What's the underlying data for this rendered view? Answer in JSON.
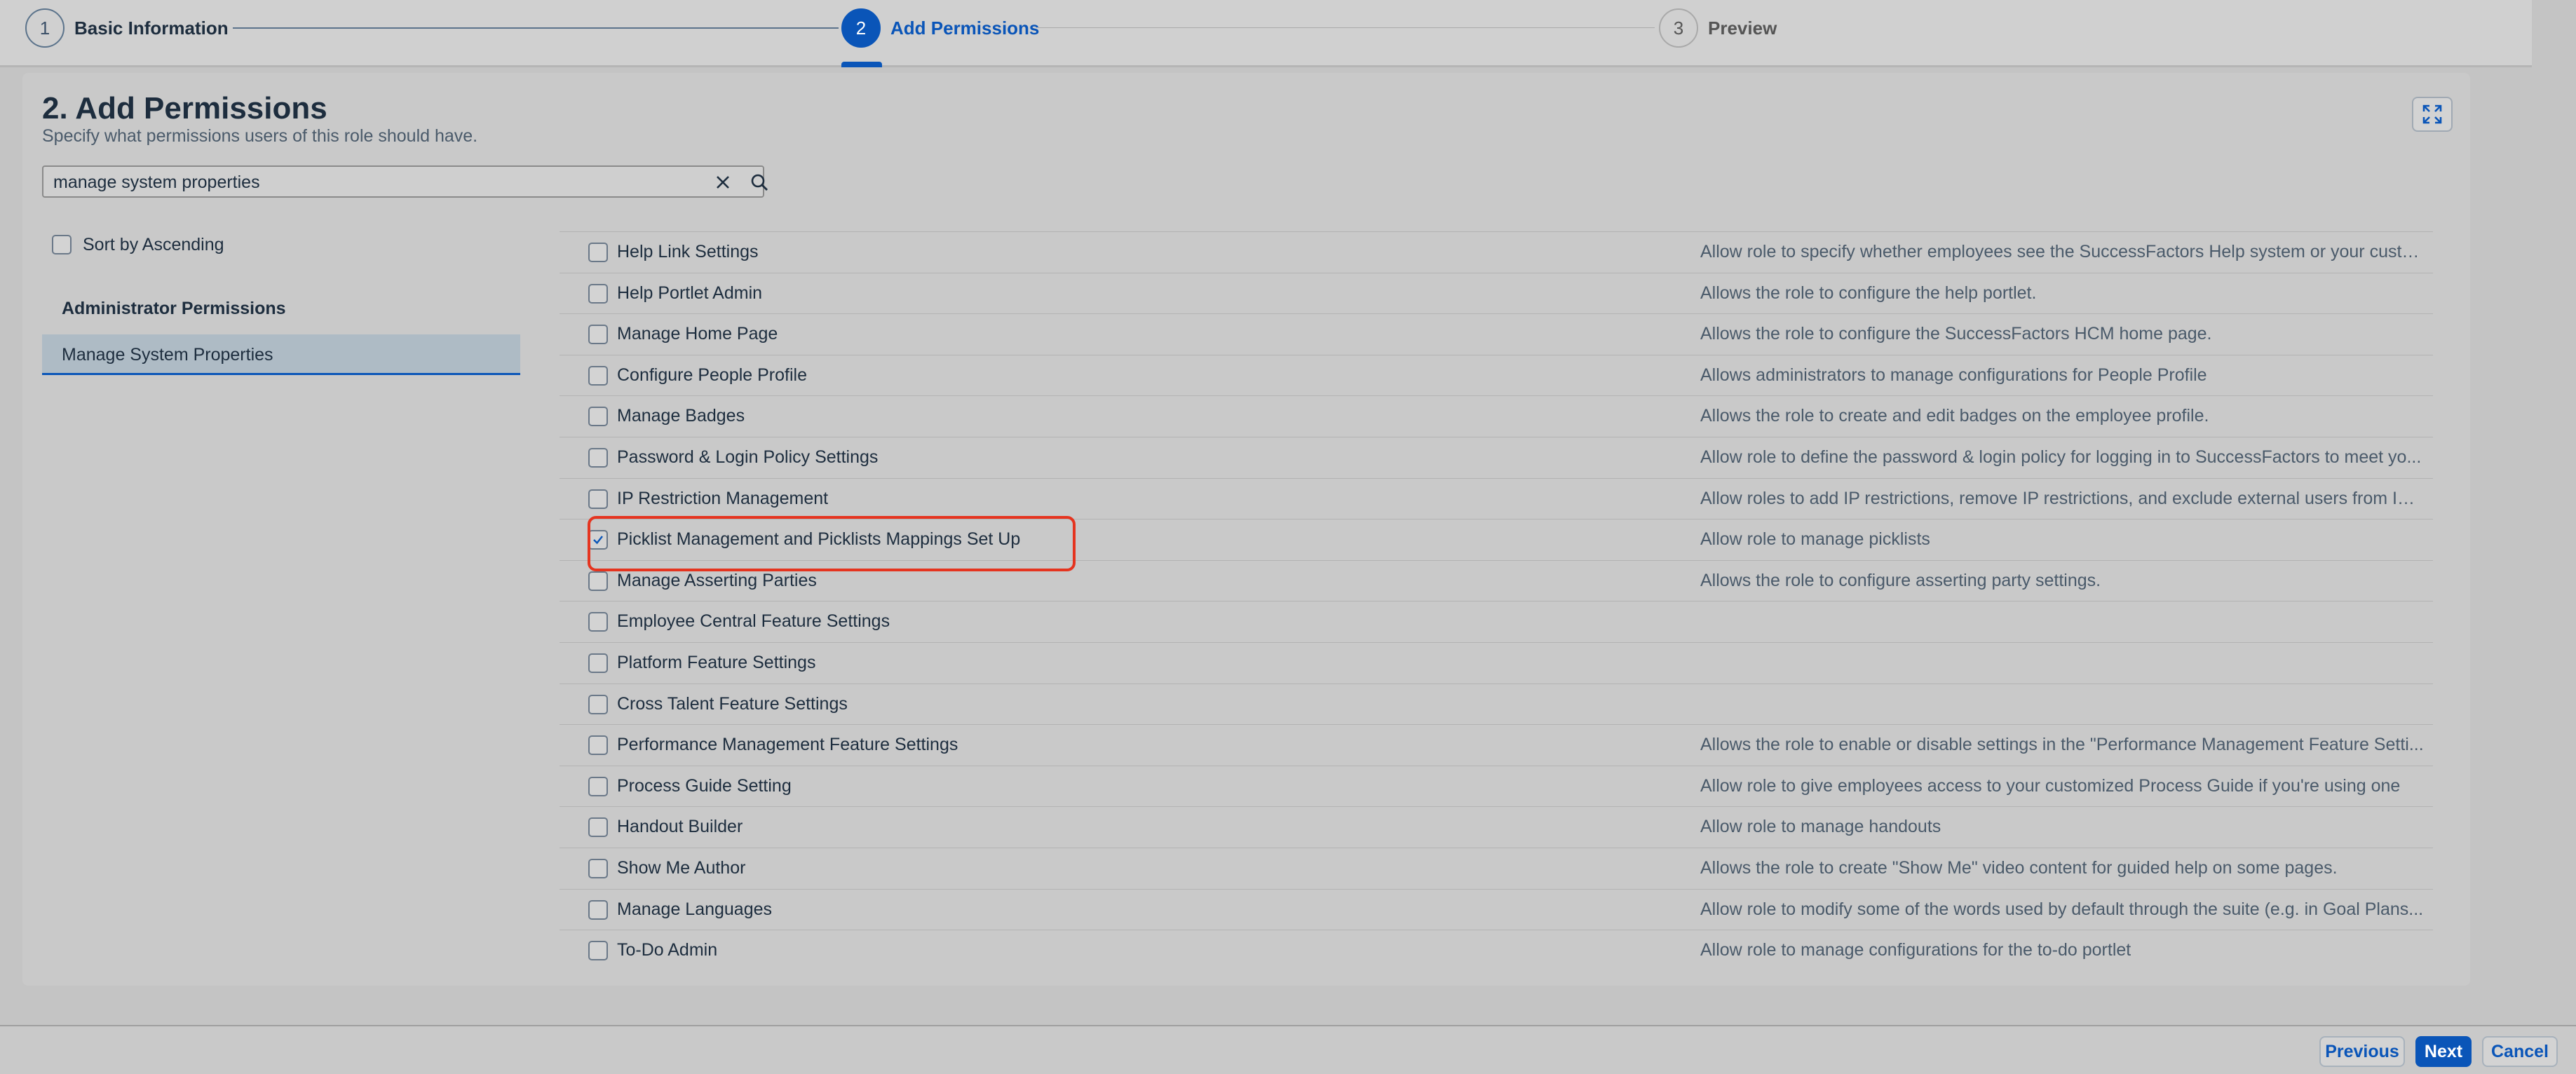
{
  "wizard": {
    "steps": [
      {
        "number": "1",
        "label": "Basic Information",
        "state": "completed"
      },
      {
        "number": "2",
        "label": "Add Permissions",
        "state": "active"
      },
      {
        "number": "3",
        "label": "Preview",
        "state": "disabled"
      }
    ]
  },
  "page": {
    "title": "2. Add Permissions",
    "subtitle": "Specify what permissions users of this role should have."
  },
  "search": {
    "value": "manage system properties"
  },
  "sort": {
    "label": "Sort by Ascending",
    "checked": false
  },
  "sidebar": {
    "section_header": "Administrator Permissions",
    "items": [
      {
        "label": "Manage System Properties",
        "selected": true
      }
    ]
  },
  "permissions": [
    {
      "name": "Help Link Settings",
      "description": "Allow role to specify whether employees see the SuccessFactors Help system or your custo...",
      "checked": false
    },
    {
      "name": "Help Portlet Admin",
      "description": "Allows the role to configure the help portlet.",
      "checked": false
    },
    {
      "name": "Manage Home Page",
      "description": "Allows the role to configure the SuccessFactors HCM home page.",
      "checked": false
    },
    {
      "name": "Configure People Profile",
      "description": "Allows administrators to manage configurations for People Profile",
      "checked": false
    },
    {
      "name": "Manage Badges",
      "description": "Allows the role to create and edit badges on the employee profile.",
      "checked": false
    },
    {
      "name": "Password & Login Policy Settings",
      "description": "Allow role to define the password & login policy for logging in to SuccessFactors to meet yo...",
      "checked": false
    },
    {
      "name": "IP Restriction Management",
      "description": "Allow roles to add IP restrictions, remove IP restrictions, and exclude external users from IP ...",
      "checked": false
    },
    {
      "name": "Picklist Management and Picklists Mappings Set Up",
      "description": "Allow role to manage picklists",
      "checked": true
    },
    {
      "name": "Manage Asserting Parties",
      "description": "Allows the role to configure asserting party settings.",
      "checked": false
    },
    {
      "name": "Employee Central Feature Settings",
      "description": "",
      "checked": false
    },
    {
      "name": "Platform Feature Settings",
      "description": "",
      "checked": false
    },
    {
      "name": "Cross Talent Feature Settings",
      "description": "",
      "checked": false
    },
    {
      "name": "Performance Management Feature Settings",
      "description": "Allows the role to enable or disable settings in the \"Performance Management Feature Setti...",
      "checked": false
    },
    {
      "name": "Process Guide Setting",
      "description": "Allow role to give employees access to your customized Process Guide if you're using one",
      "checked": false
    },
    {
      "name": "Handout Builder",
      "description": "Allow role to manage handouts",
      "checked": false
    },
    {
      "name": "Show Me Author",
      "description": "Allows the role to create \"Show Me\" video content for guided help on some pages.",
      "checked": false
    },
    {
      "name": "Manage Languages",
      "description": "Allow role to modify some of the words used by default through the suite (e.g. in Goal Plans...",
      "checked": false
    },
    {
      "name": "To-Do Admin",
      "description": "Allow role to manage configurations for the to-do portlet",
      "checked": false
    }
  ],
  "footer": {
    "previous_label": "Previous",
    "next_label": "Next",
    "cancel_label": "Cancel"
  },
  "colors": {
    "accent": "#0a55b8",
    "highlight": "#e5341f"
  }
}
